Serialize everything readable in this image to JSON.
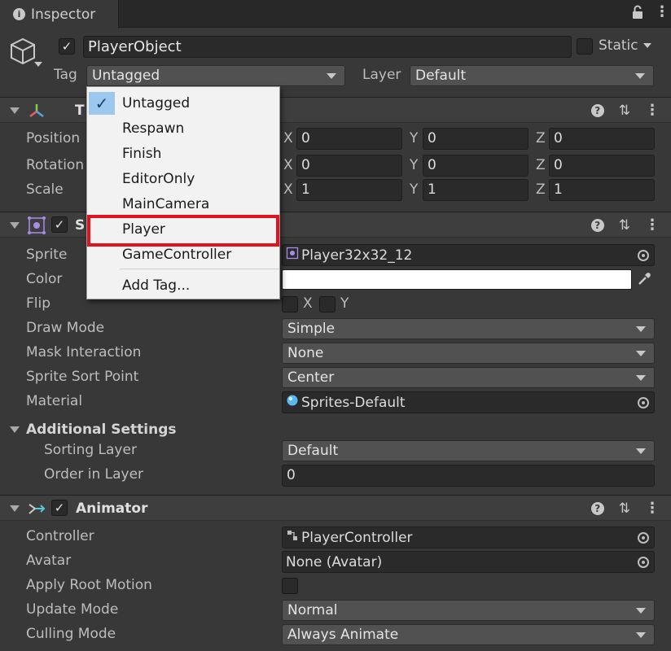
{
  "tab": {
    "title": "Inspector"
  },
  "object": {
    "name": "PlayerObject",
    "static_label": "Static"
  },
  "tag": {
    "label": "Tag",
    "value": "Untagged"
  },
  "layer": {
    "label": "Layer",
    "value": "Default"
  },
  "tag_menu": {
    "items": [
      "Untagged",
      "Respawn",
      "Finish",
      "EditorOnly",
      "MainCamera",
      "Player",
      "GameController"
    ],
    "selected": "Untagged",
    "add_label": "Add Tag..."
  },
  "transform": {
    "title_partial": "T",
    "rows": [
      {
        "label": "Position",
        "x": "0",
        "y": "0",
        "z": "0"
      },
      {
        "label": "Rotation",
        "x": "0",
        "y": "0",
        "z": "0"
      },
      {
        "label": "Scale",
        "x": "1",
        "y": "1",
        "z": "1"
      }
    ],
    "axes": [
      "X",
      "Y",
      "Z"
    ]
  },
  "sprite_renderer": {
    "title_partial": "S",
    "sprite": {
      "label": "Sprite",
      "value": "Player32x32_12"
    },
    "color": {
      "label": "Color",
      "value": "#ffffff"
    },
    "flip": {
      "label": "Flip",
      "x": "X",
      "y": "Y"
    },
    "draw_mode": {
      "label": "Draw Mode",
      "value": "Simple"
    },
    "mask_interaction": {
      "label": "Mask Interaction",
      "value": "None"
    },
    "sort_point": {
      "label": "Sprite Sort Point",
      "value": "Center"
    },
    "material": {
      "label": "Material",
      "value": "Sprites-Default"
    },
    "additional": {
      "label": "Additional Settings"
    },
    "sorting_layer": {
      "label": "Sorting Layer",
      "value": "Default"
    },
    "order_in_layer": {
      "label": "Order in Layer",
      "value": "0"
    }
  },
  "animator": {
    "title": "Animator",
    "controller": {
      "label": "Controller",
      "value": "PlayerController"
    },
    "avatar": {
      "label": "Avatar",
      "value": "None (Avatar)"
    },
    "apply_root_motion": {
      "label": "Apply Root Motion"
    },
    "update_mode": {
      "label": "Update Mode",
      "value": "Normal"
    },
    "culling_mode": {
      "label": "Culling Mode",
      "value": "Always Animate"
    }
  },
  "colors": {
    "accent_highlight": "#e0141e",
    "selected_check_bg": "#9cc8f0"
  }
}
